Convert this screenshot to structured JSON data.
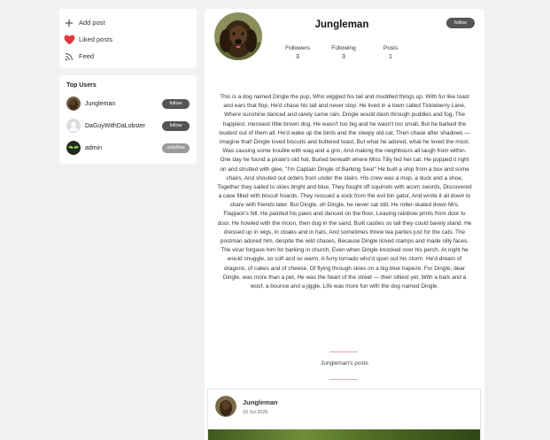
{
  "sidebar": {
    "nav": [
      {
        "label": "Add post",
        "icon": "plus-icon"
      },
      {
        "label": "Liked posts",
        "icon": "heart-icon"
      },
      {
        "label": "Feed",
        "icon": "rss-icon"
      }
    ],
    "top_users_title": "Top Users",
    "top_users": [
      {
        "name": "Jungleman",
        "button": "follow"
      },
      {
        "name": "DaGuyWithDaLobster",
        "button": "follow"
      },
      {
        "name": "admin",
        "button": "unfollow"
      }
    ]
  },
  "profile": {
    "name": "Jungleman",
    "follow_label": "follow",
    "stats": [
      {
        "label": "Followers",
        "value": "3"
      },
      {
        "label": "Following",
        "value": "3"
      },
      {
        "label": "Posts",
        "value": "1"
      }
    ],
    "bio": "This is a dog named Dingle the pup, Who wiggled his tail and muddled things up. With fur like toast and ears that flop, He'd chase his tail and never stop. He lived in a town called Tickleberry Lane, Where sunshine danced and rarely came rain. Dingle would dash through puddles and fog, The happiest, messiest little brown dog. He wasn't too big and he wasn't too small, But he barked the loudest out of them all. He'd wake up the birds and the sleepy old cat, Then chase after shadows — imagine that! Dingle loved biscuits and buttered toast, But what he adored, what he loved the most, Was causing some trouble with wag and a grin, And making the neighbours all laugh from within. One day he found a pirate's old hat, Buried beneath where Miss Tilly fed her cat. He popped it right on and strutted with glee, \"I'm Captain Dingle of Barking Sea!\" He built a ship from a box and some chairs, And shouted out orders from under the stairs. His crew was a mop, a duck and a shoe, Together they sailed to skies bright and blue. They fought off squirrels with acorn swords, Discovered a cave filled with biscuit hoards. They rescued a sock from the evil bin gator, And wrote it all down to share with friends later. But Dingle, oh Dingle, he never sat still, He roller-skated down Mrs. Flapjack's hill. He painted his paws and danced on the floor, Leaving rainbow prints from door to door. He howled with the moon, then dug in the sand, Built castles so tall they could barely stand. He dressed up in wigs, in cloaks and in hats, And sometimes threw tea parties just for the cats. The postman adored him, despite the wild chases, Because Dingle licked stamps and made silly faces. The vicar forgave him for barking in church, Even when Dingle knocked over his perch. At night he would snuggle, so soft and so warm, A furry tornado who'd spun out his storm. He'd dream of dragons, of cakes and of cheese, Of flying through skies on a big blue trapeze. For Dingle, dear Dingle, was more than a pet, He was the heart of the street — their silliest yet. With a bark and a woof, a bounce and a jiggle, Life was more fun with the dog named Dingle.",
    "posts_heading": "Jungleman's posts"
  },
  "post": {
    "author": "Jungleman",
    "date": "16 Jul 2025"
  },
  "colors": {
    "follow_button": "#555555",
    "unfollow_button": "#9a9a9a",
    "divider": "#e8a6a6",
    "heart": "#e0383e"
  }
}
